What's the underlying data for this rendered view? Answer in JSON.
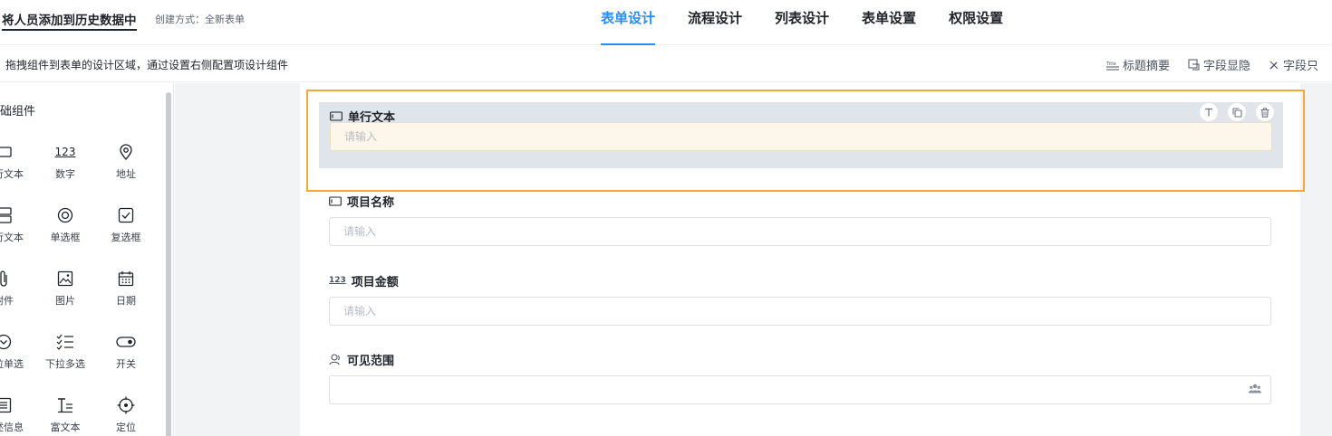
{
  "header": {
    "form_title": "将人员添加到历史数据中",
    "create_mode": "创建方式：全新表单",
    "tabs": [
      {
        "label": "表单设计",
        "active": true
      },
      {
        "label": "流程设计",
        "active": false
      },
      {
        "label": "列表设计",
        "active": false
      },
      {
        "label": "表单设置",
        "active": false
      },
      {
        "label": "权限设置",
        "active": false
      }
    ]
  },
  "subbar": {
    "hint": "拖拽组件到表单的设计区域，通过设置右侧配置项设计组件",
    "tools": {
      "title_summary": "标题摘要",
      "field_visibility": "字段显隐",
      "field_partial": "字段只"
    }
  },
  "left_panel": {
    "section_title": "基础组件",
    "components": [
      {
        "label": "单行文本",
        "icon": "single-line-icon"
      },
      {
        "label": "数字",
        "icon": "number-icon"
      },
      {
        "label": "地址",
        "icon": "location-pin-icon"
      },
      {
        "label": "多行文本",
        "icon": "multi-line-icon"
      },
      {
        "label": "单选框",
        "icon": "radio-icon"
      },
      {
        "label": "复选框",
        "icon": "checkbox-icon"
      },
      {
        "label": "附件",
        "icon": "paperclip-icon"
      },
      {
        "label": "图片",
        "icon": "image-icon"
      },
      {
        "label": "日期",
        "icon": "calendar-icon"
      },
      {
        "label": "下拉单选",
        "icon": "dropdown-icon"
      },
      {
        "label": "下拉多选",
        "icon": "list-check-icon"
      },
      {
        "label": "开关",
        "icon": "toggle-icon"
      },
      {
        "label": "描述信息",
        "icon": "description-icon"
      },
      {
        "label": "富文本",
        "icon": "rich-text-icon"
      },
      {
        "label": "定位",
        "icon": "crosshair-icon"
      }
    ]
  },
  "canvas": {
    "fields": [
      {
        "label": "单行文本",
        "placeholder": "请输入",
        "icon": "single-line-icon",
        "selected": true
      },
      {
        "label": "项目名称",
        "placeholder": "请输入",
        "icon": "single-line-icon"
      },
      {
        "label": "项目金额",
        "placeholder": "请输入",
        "icon": "number-icon",
        "icon_text": "123"
      },
      {
        "label": "可见范围",
        "placeholder": "",
        "icon": "user-icon"
      }
    ]
  },
  "colors": {
    "accent": "#2a8df0",
    "selection": "#f0a93a"
  }
}
